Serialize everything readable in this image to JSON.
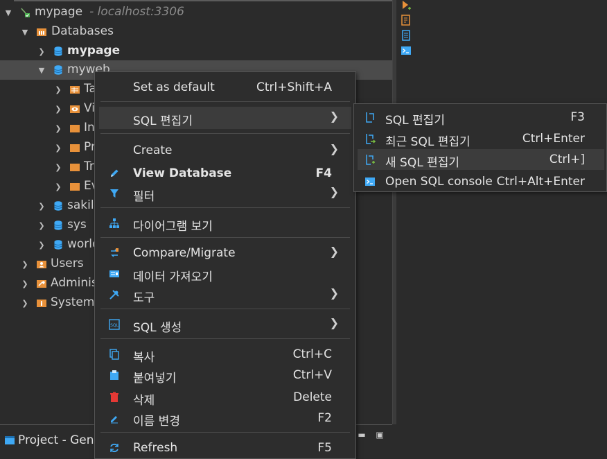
{
  "tree": {
    "connection": {
      "name": "mypage",
      "host": "- localhost:3306"
    },
    "databases_label": "Databases",
    "db_mypage": "mypage",
    "db_myweb": "myweb",
    "myweb_children": [
      "Ta",
      "Vi",
      "In",
      "Pr",
      "Tr",
      "Ev"
    ],
    "db_sakila": "sakila",
    "db_sys": "sys",
    "db_world": "world",
    "users": "Users",
    "admin": "Adminis",
    "system": "System"
  },
  "bottom": {
    "tab_label": "Project - Gene"
  },
  "context_menu": {
    "set_default": {
      "label": "Set as default",
      "shortcut": "Ctrl+Shift+A"
    },
    "sql_editor": {
      "label": "SQL 편집기"
    },
    "create": {
      "label": "Create"
    },
    "view_database": {
      "label": "View Database",
      "shortcut": "F4"
    },
    "filter": {
      "label": "필터"
    },
    "diagram": {
      "label": "다이어그램 보기"
    },
    "compare": {
      "label": "Compare/Migrate"
    },
    "import_data": {
      "label": "데이터 가져오기"
    },
    "tools": {
      "label": "도구"
    },
    "generate_sql": {
      "label": "SQL 생성"
    },
    "copy": {
      "label": "복사",
      "shortcut": "Ctrl+C"
    },
    "paste": {
      "label": "붙여넣기",
      "shortcut": "Ctrl+V"
    },
    "delete": {
      "label": "삭제",
      "shortcut": "Delete"
    },
    "rename": {
      "label": "이름 변경",
      "shortcut": "F2"
    },
    "refresh": {
      "label": "Refresh",
      "shortcut": "F5"
    }
  },
  "submenu": {
    "sql_editor": {
      "label": "SQL 편집기",
      "shortcut": "F3"
    },
    "recent_sql_editor": {
      "label": "최근 SQL 편집기",
      "shortcut": "Ctrl+Enter"
    },
    "new_sql_editor": {
      "label": "새 SQL 편집기",
      "shortcut": "Ctrl+]"
    },
    "open_console": {
      "label": "Open SQL console",
      "shortcut": "Ctrl+Alt+Enter"
    }
  },
  "colors": {
    "accent_blue": "#3fa9f5",
    "folder_orange": "#e8913a",
    "delete_red": "#e53935"
  }
}
